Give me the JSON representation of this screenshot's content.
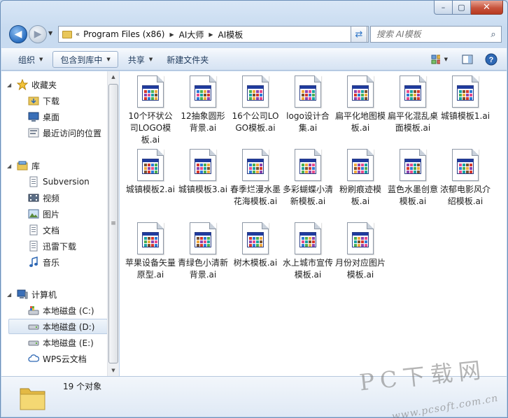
{
  "window": {
    "caption": {
      "minimize": "–",
      "maximize": "▢",
      "close": "✕"
    }
  },
  "nav": {
    "breadcrumb_prefix": "«",
    "breadcrumbs": [
      "Program Files (x86)",
      "AI大师",
      "AI模板"
    ],
    "search_placeholder": "搜索 AI模板"
  },
  "toolbar": {
    "organize": "组织",
    "include_in_library": "包含到库中",
    "share": "共享",
    "new_folder": "新建文件夹"
  },
  "sidebar": {
    "favorites": {
      "label": "收藏夹",
      "items": [
        "下载",
        "桌面",
        "最近访问的位置"
      ]
    },
    "libraries": {
      "label": "库",
      "items": [
        "Subversion",
        "视频",
        "图片",
        "文档",
        "迅雷下载",
        "音乐"
      ]
    },
    "computer": {
      "label": "计算机",
      "items": [
        "本地磁盘 (C:)",
        "本地磁盘 (D:)",
        "本地磁盘 (E:)",
        "WPS云文档"
      ],
      "selected": "本地磁盘 (D:)"
    }
  },
  "files": [
    "10个环状公司LOGO模板.ai",
    "12抽象圆形背景.ai",
    "16个公司LOGO模板.ai",
    "logo设计合集.ai",
    "扁平化地图模板.ai",
    "扁平化混乱桌面模板.ai",
    "城镇模板1.ai",
    "城镇模板2.ai",
    "城镇模板3.ai",
    "春季烂漫水墨花海模板.ai",
    "多彩蝴蝶小清新模板.ai",
    "粉刷痕迹模板.ai",
    "蓝色水墨创意模板.ai",
    "浓郁电影风介绍模板.ai",
    "苹果设备矢量原型.ai",
    "青绿色小清新背景.ai",
    "树木模板.ai",
    "水上城市宣传模板.ai",
    "月份对应图片模板.ai"
  ],
  "status": {
    "count_text": "19 个对象"
  },
  "watermark": {
    "brand": "PC下载网",
    "url": "www.pcsoft.com.cn"
  },
  "colors": {
    "accent": "#2a6ec0",
    "selection": "#dce7f4",
    "icon_blue": "#1f3b9e"
  }
}
